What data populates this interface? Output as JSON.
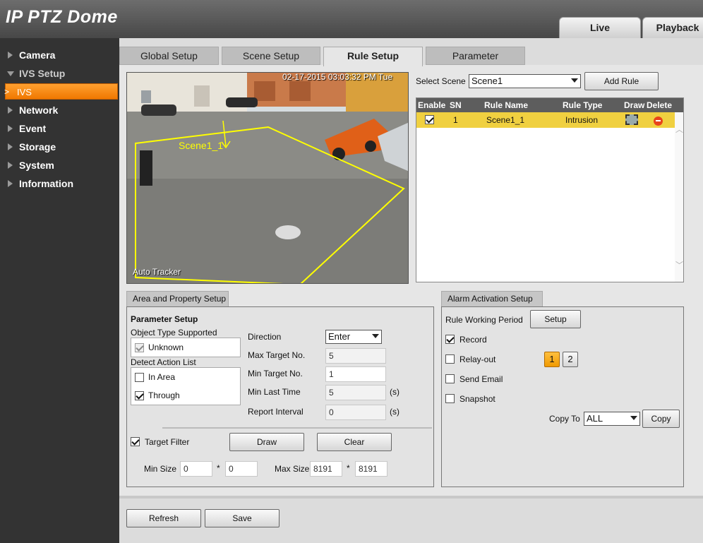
{
  "header": {
    "title": "IP PTZ Dome",
    "tabs": [
      {
        "label": "Live"
      },
      {
        "label": "Playback"
      }
    ]
  },
  "sidebar": {
    "items": [
      {
        "label": "Camera"
      },
      {
        "label": "IVS Setup"
      },
      {
        "label": "IVS"
      },
      {
        "label": "Network"
      },
      {
        "label": "Event"
      },
      {
        "label": "Storage"
      },
      {
        "label": "System"
      },
      {
        "label": "Information"
      }
    ]
  },
  "tabs": [
    {
      "label": "Global Setup"
    },
    {
      "label": "Scene Setup"
    },
    {
      "label": "Rule Setup"
    },
    {
      "label": "Parameter"
    }
  ],
  "video": {
    "timestamp": "02-17-2015 03:03:32 PM Tue",
    "rule_label": "Scene1_1",
    "tracker_label": "Auto Tracker",
    "overlay_color": "#ffff00"
  },
  "scene": {
    "label": "Select Scene",
    "value": "Scene1",
    "add_rule_label": "Add Rule"
  },
  "rule_table": {
    "headers": [
      "Enable",
      "SN",
      "Rule Name",
      "Rule Type",
      "Draw",
      "Delete"
    ],
    "rows": [
      {
        "enabled": true,
        "sn": "1",
        "name": "Scene1_1",
        "type": "Intrusion"
      }
    ]
  },
  "area": {
    "tab_label": "Area and Property Setup",
    "parameter_setup": "Parameter Setup",
    "object_type_label": "Object Type Supported",
    "object_types": [
      {
        "label": "Unknown",
        "checked": true
      }
    ],
    "detect_action_label": "Detect Action List",
    "actions": [
      {
        "label": "In Area",
        "checked": false
      },
      {
        "label": "Through",
        "checked": true
      }
    ],
    "direction_label": "Direction",
    "direction_value": "Enter",
    "max_target_label": "Max Target No.",
    "max_target_value": "5",
    "min_target_label": "Min Target No.",
    "min_target_value": "1",
    "min_last_time_label": "Min Last Time",
    "min_last_time_value": "5",
    "report_interval_label": "Report Interval",
    "report_interval_value": "0",
    "unit_s": "(s)",
    "target_filter_label": "Target Filter",
    "draw_label": "Draw",
    "clear_label": "Clear",
    "min_size_label": "Min Size",
    "min_size_w": "0",
    "min_size_h": "0",
    "max_size_label": "Max Size",
    "max_size_w": "8191",
    "max_size_h": "8191",
    "times": "*"
  },
  "alarm": {
    "tab_label": "Alarm Activation Setup",
    "working_period_label": "Rule Working Period",
    "setup_label": "Setup",
    "record_label": "Record",
    "relay_label": "Relay-out",
    "relay_1": "1",
    "relay_2": "2",
    "email_label": "Send Email",
    "snapshot_label": "Snapshot",
    "copy_to_label": "Copy To",
    "copy_to_value": "ALL",
    "copy_label": "Copy"
  },
  "footer": {
    "refresh_label": "Refresh",
    "save_label": "Save"
  }
}
